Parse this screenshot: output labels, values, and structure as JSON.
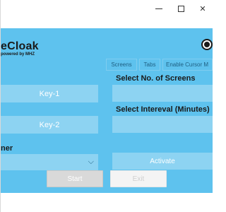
{
  "window_controls": {
    "close_glyph": "✕"
  },
  "header": {
    "logo_title": "eCloak",
    "logo_subtitle": "powered by MHZ",
    "radio_selected": true
  },
  "tabs": [
    {
      "label": "Screens"
    },
    {
      "label": "Tabs"
    },
    {
      "label": "Enable Cursor M"
    }
  ],
  "keys": {
    "key1_label": "Key-1",
    "key2_label": "Key-2"
  },
  "labels": {
    "screens": "Select No. of Screens",
    "interval": "Select Intereval (Minutes)",
    "runner": "ner"
  },
  "inputs": {
    "screens_value": "",
    "interval_value": ""
  },
  "dropdown": {
    "selected": "",
    "chevron": "⌵"
  },
  "buttons": {
    "activate": "Activate",
    "start": "Start",
    "exit": "Exit"
  },
  "colors": {
    "panel": "#5ec2ee",
    "field": "#8dd3f2",
    "tab_text": "#1e5f82"
  }
}
